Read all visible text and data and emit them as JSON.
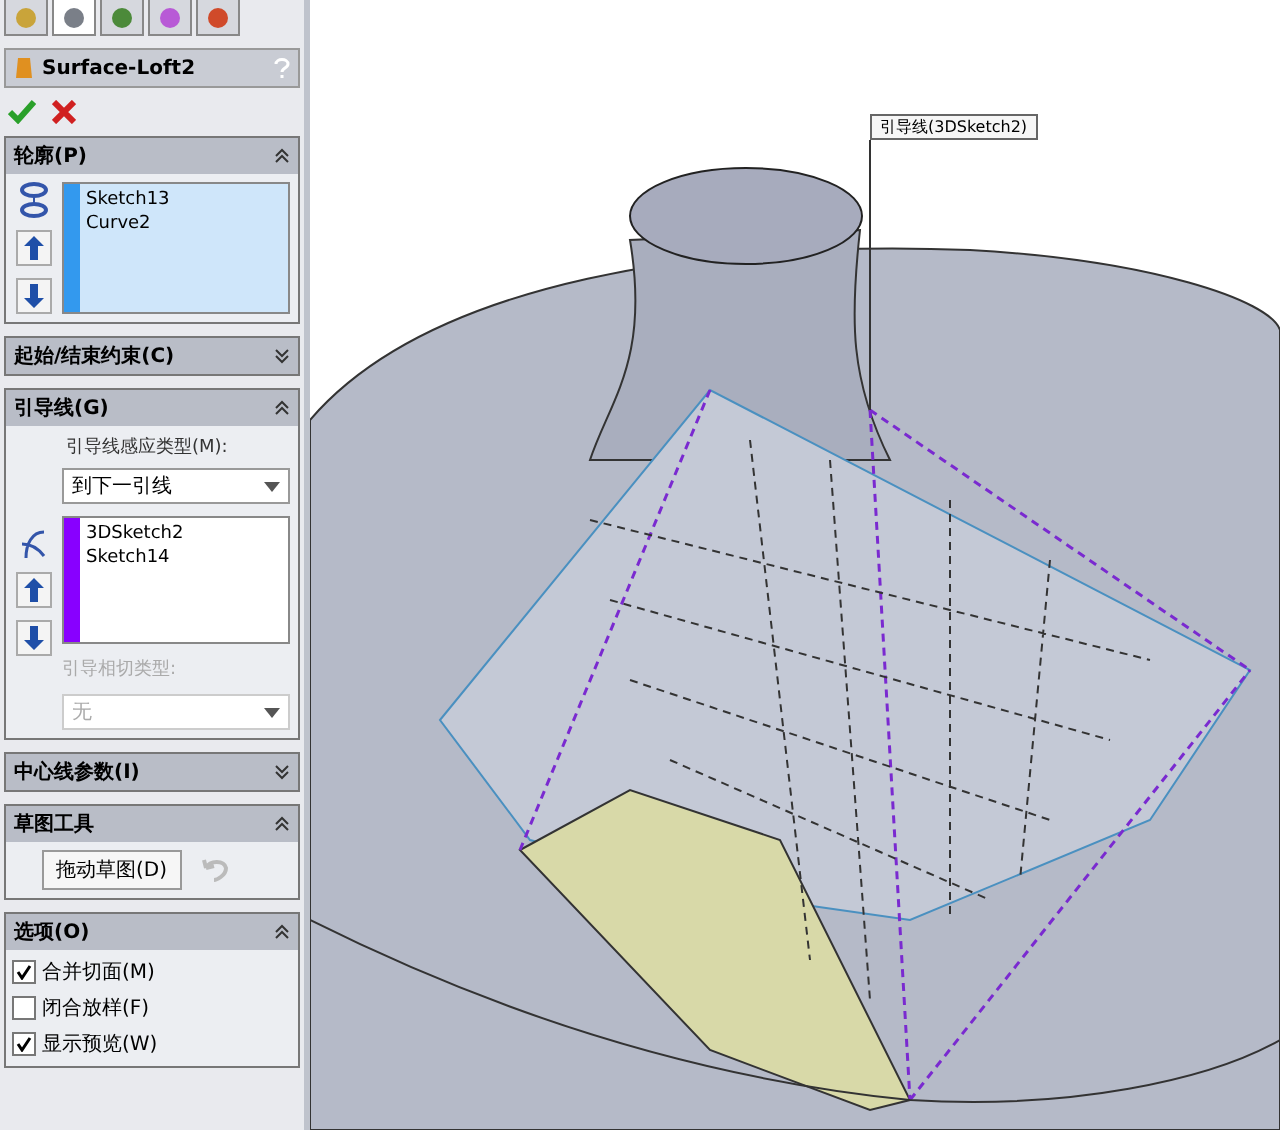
{
  "panel_tabs": [
    {
      "selected": false
    },
    {
      "selected": true
    },
    {
      "selected": false
    },
    {
      "selected": false
    },
    {
      "selected": false
    }
  ],
  "feature": {
    "title": "Surface-Loft2"
  },
  "sections": [
    {
      "kind": "list",
      "title": "轮廓(P)",
      "expanded": true,
      "color": "#3399ee",
      "items": [
        "Sketch13",
        "Curve2"
      ]
    },
    {
      "title": "起始/结束约束(C)",
      "expanded": false
    },
    {
      "kind": "guides",
      "title": "引导线(G)",
      "expanded": true,
      "color": "#8800ff",
      "type_label": "引导线感应类型(M):",
      "type_value": "到下一引线",
      "items": [
        "3DSketch2",
        "Sketch14"
      ],
      "tangent_label": "引导相切类型:",
      "tangent_value": "无",
      "tangent_disabled": true
    },
    {
      "title": "中心线参数(I)",
      "expanded": false
    },
    {
      "kind": "tools",
      "title": "草图工具",
      "expanded": true,
      "button": "拖动草图(D)",
      "undo_disabled": true
    },
    {
      "kind": "options",
      "title": "选项(O)",
      "expanded": true,
      "options": [
        {
          "label": "合并切面(M)",
          "checked": true
        },
        {
          "label": "闭合放样(F)",
          "checked": false
        },
        {
          "label": "显示预览(W)",
          "checked": true
        }
      ]
    }
  ],
  "viewport": {
    "callout": "引导线(3DSketch2)"
  }
}
